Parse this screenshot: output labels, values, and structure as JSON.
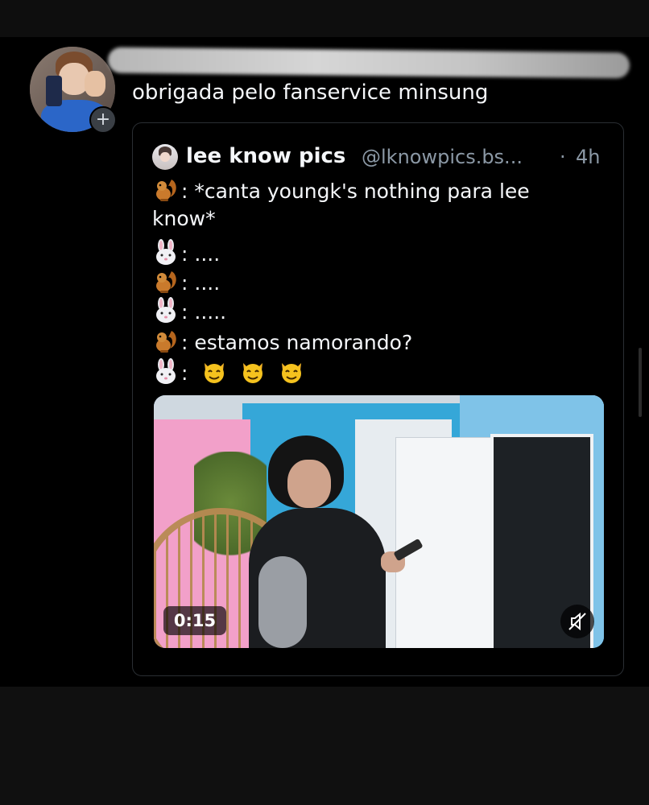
{
  "post": {
    "text": "obrigada pelo fanservice minsung",
    "avatar_plus": "+"
  },
  "quote": {
    "name": "lee know pics",
    "handle": "@lknowpics.bs...",
    "separator": "·",
    "time": "4h",
    "lines": [
      {
        "emoji": "squirrel-icon",
        "text": ": *canta youngk's nothing para lee"
      },
      {
        "emoji": "",
        "text": "know*"
      },
      {
        "emoji": "rabbit-face-icon",
        "text": ": ...."
      },
      {
        "emoji": "squirrel-icon",
        "text": ": ...."
      },
      {
        "emoji": "rabbit-face-icon",
        "text": ": ....."
      },
      {
        "emoji": "squirrel-icon",
        "text": ": estamos namorando?"
      },
      {
        "emoji": "rabbit-face-icon",
        "text": ": ",
        "extra": [
          "smiling-cat-devil-icon",
          "smiling-cat-devil-icon",
          "smiling-cat-devil-icon"
        ]
      }
    ],
    "media": {
      "duration": "0:15",
      "mute_icon": "muted-speaker-icon"
    }
  },
  "colors": {
    "background": "#000000",
    "text": "#f5f7fa",
    "muted_text": "#8b98a5",
    "border": "#2a2e33"
  }
}
